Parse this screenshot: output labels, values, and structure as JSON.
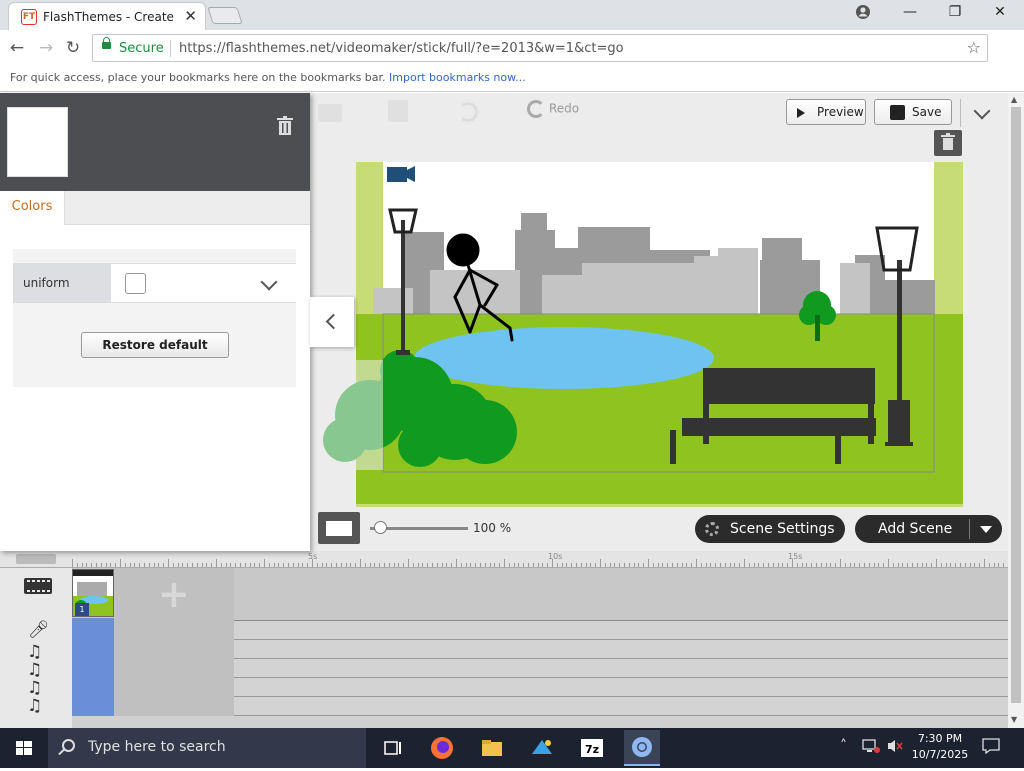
{
  "browser": {
    "tab_title": "FlashThemes - Create",
    "tab_icon": "FT",
    "secure_label": "Secure",
    "url": "https://flashthemes.net/videomaker/stick/full/?e=2013&w=1&ct=go",
    "bookmarks_hint": "For quick access, place your bookmarks here on the bookmarks bar.",
    "bookmarks_link": "Import bookmarks now..."
  },
  "toolbar": {
    "redo_label": "Redo",
    "preview_label": "Preview",
    "save_label": "Save"
  },
  "left_panel": {
    "tab_colors": "Colors",
    "color_row_label": "uniform",
    "restore_label": "Restore default"
  },
  "stage_controls": {
    "zoom_value": "100 %",
    "zoom_level": 0.1,
    "scene_settings_label": "Scene Settings",
    "add_scene_label": "Add Scene"
  },
  "timeline": {
    "ruler_labels": [
      "5s",
      "10s",
      "15s"
    ],
    "scene_number": "1"
  },
  "taskbar": {
    "search_placeholder": "Type here to search",
    "time": "7:30 PM",
    "date": "10/7/2025"
  },
  "colors": {
    "accent_orange": "#d06a1c",
    "secure_green": "#1e8e3e",
    "grass": "#8fc31f",
    "pond": "#6fc3f0",
    "bush": "#119a20"
  }
}
